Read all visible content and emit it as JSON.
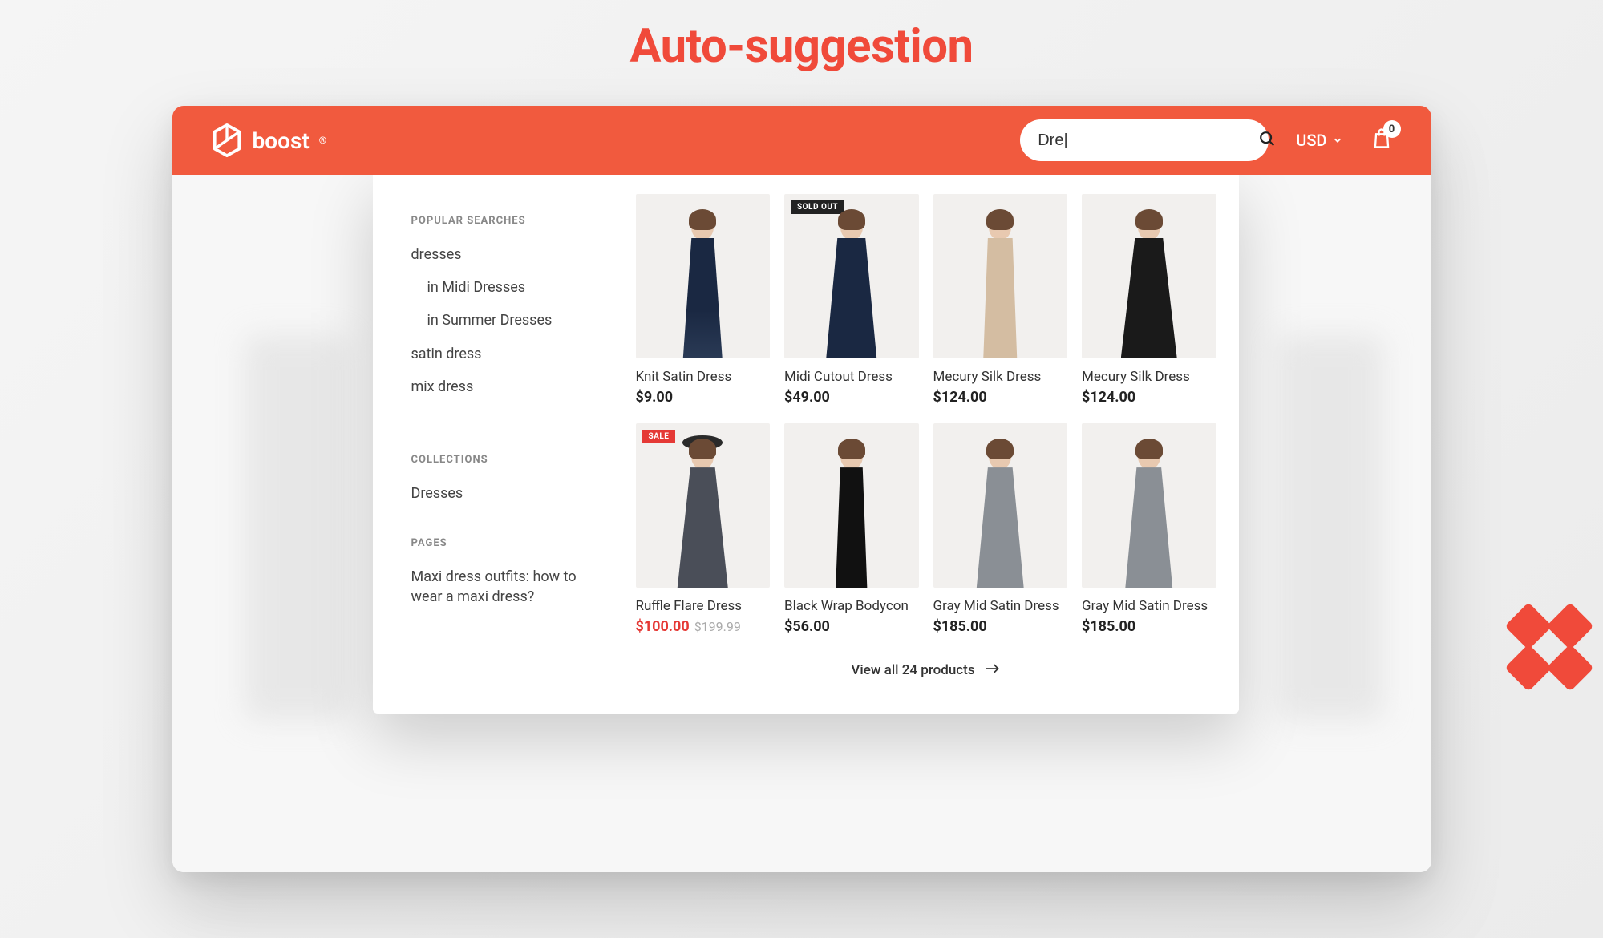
{
  "page_heading": "Auto-suggestion",
  "header": {
    "brand": "boost",
    "search_value": "Dre|",
    "currency": "USD",
    "cart_count": "0"
  },
  "dropdown": {
    "popular_heading": "POPULAR SEARCHES",
    "popular_items": [
      {
        "label": "dresses",
        "indent": false
      },
      {
        "label": "in Midi Dresses",
        "indent": true
      },
      {
        "label": "in Summer Dresses",
        "indent": true
      },
      {
        "label": "satin dress",
        "indent": false
      },
      {
        "label": "mix dress",
        "indent": false
      }
    ],
    "collections_heading": "COLLECTIONS",
    "collections": [
      {
        "label": "Dresses"
      }
    ],
    "pages_heading": "PAGES",
    "pages": [
      {
        "label": "Maxi dress outfits: how to wear a maxi dress?"
      }
    ],
    "view_all": "View all 24 products"
  },
  "products": [
    {
      "title": "Knit Satin Dress",
      "price": "$9.00",
      "badge": "",
      "sale": false,
      "old": "",
      "style": "d-navy",
      "hat": false
    },
    {
      "title": "Midi Cutout Dress",
      "price": "$49.00",
      "badge": "SOLD OUT",
      "badge_class": "soldout",
      "sale": false,
      "old": "",
      "style": "d-navy-midi",
      "hat": false
    },
    {
      "title": "Mecury Silk Dress",
      "price": "$124.00",
      "badge": "",
      "sale": false,
      "old": "",
      "style": "d-tan",
      "hat": false
    },
    {
      "title": "Mecury Silk Dress",
      "price": "$124.00",
      "badge": "",
      "sale": false,
      "old": "",
      "style": "d-black",
      "hat": false
    },
    {
      "title": "Ruffle Flare Dress",
      "price": "$100.00",
      "badge": "SALE",
      "badge_class": "sale",
      "sale": true,
      "old": "$199.99",
      "style": "d-charcoal",
      "hat": true
    },
    {
      "title": "Black Wrap Bodycon",
      "price": "$56.00",
      "badge": "",
      "sale": false,
      "old": "",
      "style": "d-blacklong",
      "hat": false
    },
    {
      "title": "Gray Mid Satin Dress",
      "price": "$185.00",
      "badge": "",
      "sale": false,
      "old": "",
      "style": "d-gray",
      "hat": false
    },
    {
      "title": "Gray Mid Satin Dress",
      "price": "$185.00",
      "badge": "",
      "sale": false,
      "old": "",
      "style": "d-gray",
      "hat": false
    }
  ]
}
